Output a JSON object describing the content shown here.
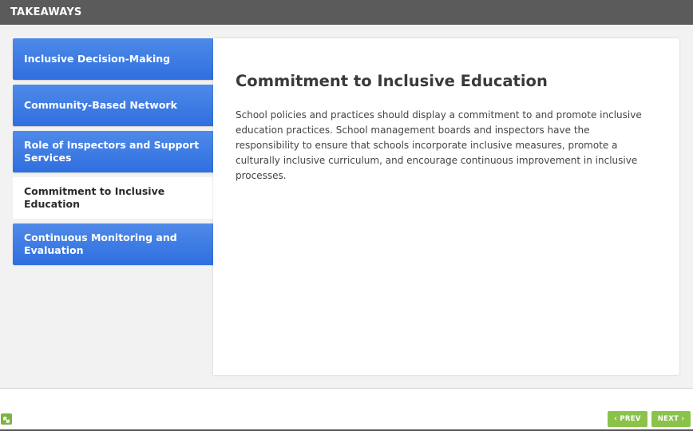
{
  "header": {
    "title": "TAKEAWAYS"
  },
  "tabs": [
    {
      "label": "Inclusive Decision-Making"
    },
    {
      "label": "Community-Based Network"
    },
    {
      "label": "Role of Inspectors and Support Services"
    },
    {
      "label": "Commitment to Inclusive Education"
    },
    {
      "label": "Continuous Monitoring and Evaluation"
    }
  ],
  "active_tab": "Commitment to Inclusive Education",
  "content": {
    "title": "Commitment to Inclusive Education",
    "body": "School policies and practices should display a commitment to and promote inclusive education practices. School management boards and inspectors have the responsibility to ensure that schools incorporate inclusive measures, promote a culturally inclusive curriculum, and encourage continuous improvement in inclusive processes."
  },
  "nav": {
    "prev_label": "PREV",
    "next_label": "NEXT"
  },
  "icons": {
    "expand": "expand-icon",
    "prev": "chevron-left-icon",
    "next": "chevron-right-icon"
  },
  "colors": {
    "tab": "#2f6fe0",
    "header": "#5b5b5b",
    "nav_button": "#8bc34a"
  }
}
